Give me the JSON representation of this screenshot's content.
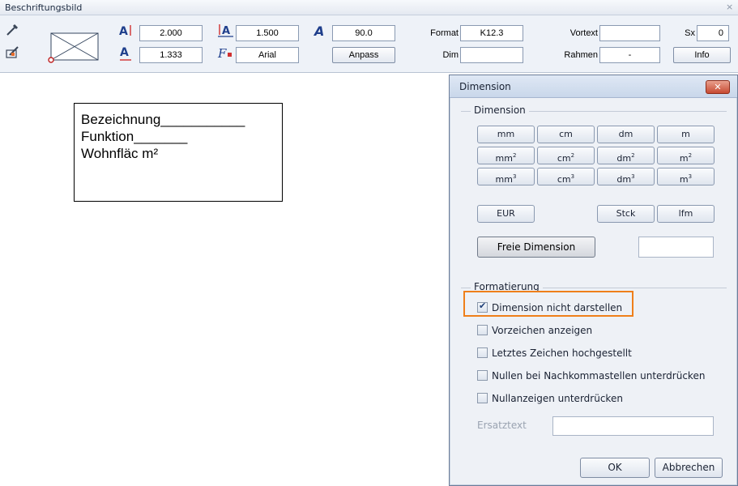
{
  "toolbar": {
    "title": "Beschriftungsbild",
    "close_glyph": "×",
    "height_value": "2.000",
    "width_value": "1.333",
    "spacing_value": "1.500",
    "font_value": "Arial",
    "angle_value": "90.0",
    "anpass_label": "Anpass",
    "format_label": "Format",
    "format_value": "K12.3",
    "dim_label": "Dim",
    "dim_value": "",
    "vortext_label": "Vortext",
    "vortext_value": "",
    "rahmen_label": "Rahmen",
    "rahmen_value": "-",
    "sx_label": "Sx",
    "sx_value": "0",
    "info_label": "Info",
    "icons": [
      "pipette-icon",
      "frame-preview-icon",
      "text-height-icon",
      "text-width-icon",
      "line-spacing-icon",
      "font-icon",
      "italic-angle-icon",
      "edit-label-icon"
    ]
  },
  "labelbox": {
    "lines": [
      "Bezeichnung___________",
      "Funktion_______",
      "Wohnfläc m²"
    ]
  },
  "dialog": {
    "title": "Dimension",
    "close_glyph": "✕",
    "group_dimension": "Dimension",
    "units_row1": [
      "mm",
      "cm",
      "dm",
      "m"
    ],
    "units_row2": [
      "mm",
      "cm",
      "dm",
      "m"
    ],
    "units_row3": [
      "mm",
      "cm",
      "dm",
      "m"
    ],
    "sup2": "2",
    "sup3": "3",
    "units_row4": [
      "EUR",
      "Stck",
      "lfm"
    ],
    "freie_label": "Freie Dimension",
    "freie_value": "",
    "group_format": "Formatierung",
    "checkboxes": [
      {
        "label": "Dimension nicht darstellen",
        "checked": true
      },
      {
        "label": "Vorzeichen anzeigen",
        "checked": false
      },
      {
        "label": "Letztes Zeichen hochgestellt",
        "checked": false
      },
      {
        "label": "Nullen bei Nachkommastellen unterdrücken",
        "checked": false
      },
      {
        "label": "Nullanzeigen unterdrücken",
        "checked": false
      }
    ],
    "ersatz_label": "Ersatztext",
    "ersatz_value": "",
    "ok_label": "OK",
    "cancel_label": "Abbrechen"
  },
  "colors": {
    "highlight": "#ef7f1a",
    "close_button": "#c74a32"
  }
}
